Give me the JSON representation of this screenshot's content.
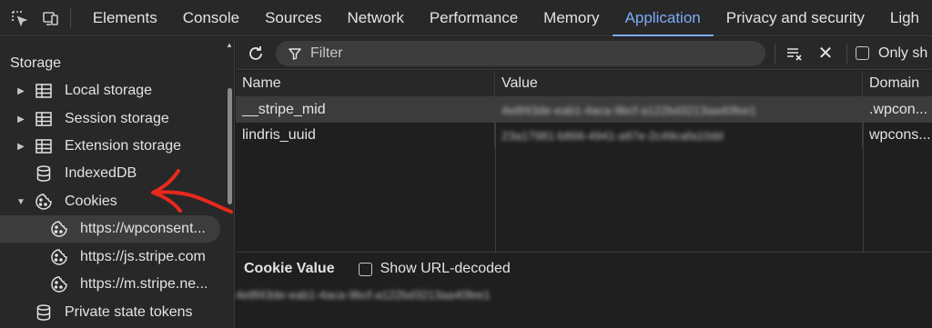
{
  "tabs": [
    {
      "label": "Elements"
    },
    {
      "label": "Console"
    },
    {
      "label": "Sources"
    },
    {
      "label": "Network"
    },
    {
      "label": "Performance"
    },
    {
      "label": "Memory"
    },
    {
      "label": "Application",
      "active": true
    },
    {
      "label": "Privacy and security"
    },
    {
      "label": "Ligh"
    }
  ],
  "sidebar": {
    "heading": "Storage",
    "items": [
      {
        "label": "Local storage",
        "icon": "table-icon",
        "expand": "collapsed"
      },
      {
        "label": "Session storage",
        "icon": "table-icon",
        "expand": "collapsed"
      },
      {
        "label": "Extension storage",
        "icon": "table-icon",
        "expand": "collapsed"
      },
      {
        "label": "IndexedDB",
        "icon": "database-icon",
        "expand": "none"
      },
      {
        "label": "Cookies",
        "icon": "cookie-icon",
        "expand": "expanded"
      },
      {
        "label": "https://wpconsent...",
        "icon": "cookie-icon",
        "expand": "child",
        "selected": true
      },
      {
        "label": "https://js.stripe.com",
        "icon": "cookie-icon",
        "expand": "child"
      },
      {
        "label": "https://m.stripe.ne...",
        "icon": "cookie-icon",
        "expand": "child"
      },
      {
        "label": "Private state tokens",
        "icon": "database-icon",
        "expand": "none"
      }
    ]
  },
  "toolbar": {
    "filter_placeholder": "Filter",
    "only_label": "Only sh"
  },
  "table": {
    "columns": [
      "Name",
      "Value",
      "Domain"
    ],
    "rows": [
      {
        "name": "__stripe_mid",
        "value": "4e8f43de-eab1-4aca-9bcf-a122bd3213aa40fee1",
        "domain": ".wpcon..."
      },
      {
        "name": "lindris_uuid",
        "value": "23a17981-b866-4941-a97e-2c49cafa10dd",
        "domain": "wpcons..."
      }
    ]
  },
  "cookie_value": {
    "title": "Cookie Value",
    "show_decoded_label": "Show URL-decoded",
    "value": "4e8f43de-eab1-4aca-9bcf-a122bd3213aa40fee1"
  },
  "colors": {
    "accent": "#7cacf8",
    "annotation_arrow": "#e8291c"
  }
}
